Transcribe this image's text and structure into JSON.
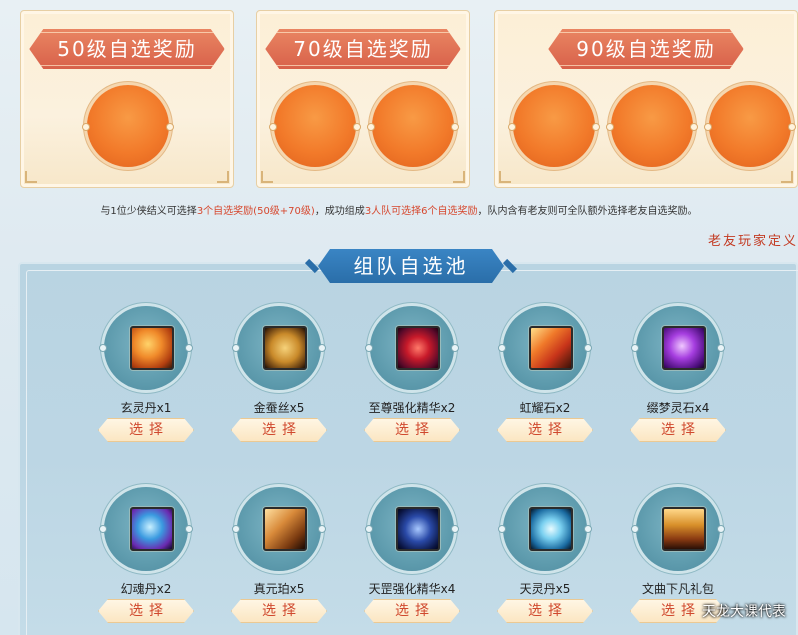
{
  "rewards": [
    {
      "title": "50级自选奖励",
      "slots": 1
    },
    {
      "title": "70级自选奖励",
      "slots": 2
    },
    {
      "title": "90级自选奖励",
      "slots": 3
    }
  ],
  "notice": {
    "p1": "与1位少侠结义可选择",
    "h1": "3个自选奖励(50级+70级)",
    "p2": "，成功组成",
    "h2": "3人队可选择6个自选奖励",
    "p3": "，队内含有老友则可全队额外选择老友自选奖励。"
  },
  "side_label": "老友玩家定义",
  "pool": {
    "title": "组队自选池",
    "button_label": "选择",
    "items": [
      {
        "name": "玄灵丹x1",
        "icon": "spiral-shell-icon"
      },
      {
        "name": "金蚕丝x5",
        "icon": "silk-cocoon-icon"
      },
      {
        "name": "至尊强化精华x2",
        "icon": "supreme-essence-icon"
      },
      {
        "name": "虹耀石x2",
        "icon": "rainbow-stone-icon"
      },
      {
        "name": "缀梦灵石x4",
        "icon": "purple-gem-icon"
      },
      {
        "name": "幻魂丹x2",
        "icon": "soul-pill-icon"
      },
      {
        "name": "真元珀x5",
        "icon": "amber-icon"
      },
      {
        "name": "天罡强化精华x4",
        "icon": "tiangang-essence-icon"
      },
      {
        "name": "天灵丹x5",
        "icon": "spirit-pill-icon"
      },
      {
        "name": "文曲下凡礼包",
        "icon": "gift-chest-icon"
      }
    ]
  },
  "watermark": "天龙大课代表",
  "colors": {
    "accent_red": "#d6482f",
    "title_blue": "#2a6ea9",
    "orb_orange": "#f27a2a"
  }
}
